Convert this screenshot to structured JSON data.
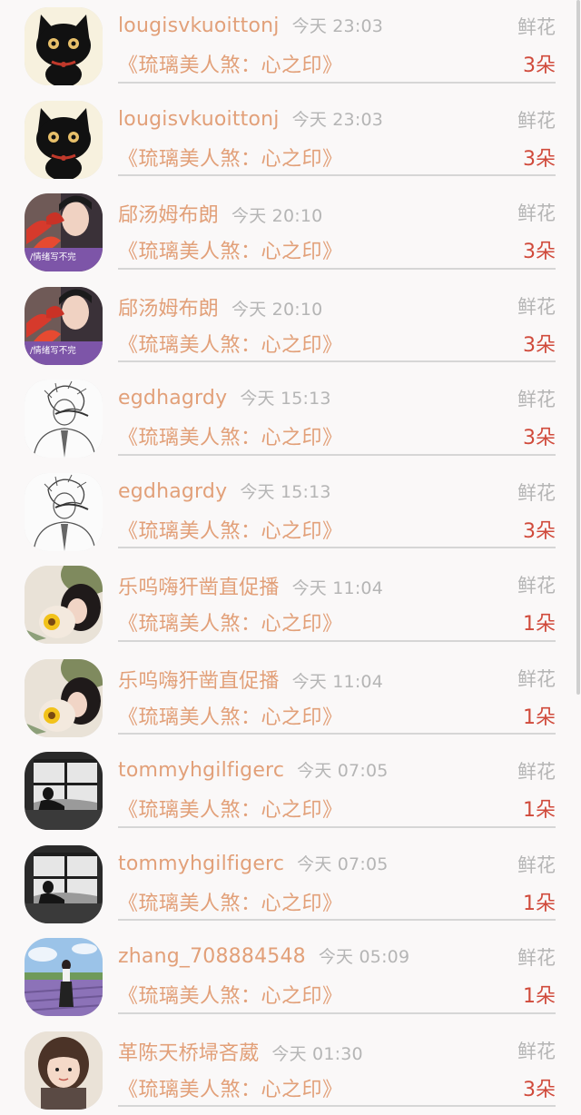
{
  "items": [
    {
      "name": "lougisvkuoittonj",
      "time": "今天 23:03",
      "gift": "鲜花",
      "title": "《琉璃美人煞：心之印》",
      "count": "3朵",
      "avatar": "black-cat"
    },
    {
      "name": "lougisvkuoittonj",
      "time": "今天 23:03",
      "gift": "鲜花",
      "title": "《琉璃美人煞：心之印》",
      "count": "3朵",
      "avatar": "black-cat"
    },
    {
      "name": "郈汤姆布朗",
      "time": "今天 20:10",
      "gift": "鲜花",
      "title": "《琉璃美人煞：心之印》",
      "count": "3朵",
      "avatar": "boy-flower",
      "avatar_caption": "/情绪写不完"
    },
    {
      "name": "郈汤姆布朗",
      "time": "今天 20:10",
      "gift": "鲜花",
      "title": "《琉璃美人煞：心之印》",
      "count": "3朵",
      "avatar": "boy-flower",
      "avatar_caption": "/情绪写不完"
    },
    {
      "name": "egdhagrdy",
      "time": "今天 15:13",
      "gift": "鲜花",
      "title": "《琉璃美人煞：心之印》",
      "count": "3朵",
      "avatar": "sketch-boy"
    },
    {
      "name": "egdhagrdy",
      "time": "今天 15:13",
      "gift": "鲜花",
      "title": "《琉璃美人煞：心之印》",
      "count": "3朵",
      "avatar": "sketch-boy"
    },
    {
      "name": "乐呜嗨犴凿直促播",
      "time": "今天 11:04",
      "gift": "鲜花",
      "title": "《琉璃美人煞：心之印》",
      "count": "1朵",
      "avatar": "girl-sunflower"
    },
    {
      "name": "乐呜嗨犴凿直促播",
      "time": "今天 11:04",
      "gift": "鲜花",
      "title": "《琉璃美人煞：心之印》",
      "count": "1朵",
      "avatar": "girl-sunflower"
    },
    {
      "name": "tommyhgilfigerc",
      "time": "今天 07:05",
      "gift": "鲜花",
      "title": "《琉璃美人煞：心之印》",
      "count": "1朵",
      "avatar": "window-silhouette"
    },
    {
      "name": "tommyhgilfigerc",
      "time": "今天 07:05",
      "gift": "鲜花",
      "title": "《琉璃美人煞：心之印》",
      "count": "1朵",
      "avatar": "window-silhouette"
    },
    {
      "name": "zhang_708884548",
      "time": "今天 05:09",
      "gift": "鲜花",
      "title": "《琉璃美人煞：心之印》",
      "count": "1朵",
      "avatar": "lavender-field"
    },
    {
      "name": "革陈天桥埽吝葳",
      "time": "今天 01:30",
      "gift": "鲜花",
      "title": "《琉璃美人煞：心之印》",
      "count": "3朵",
      "avatar": "little-girl"
    }
  ],
  "colors": {
    "name": "#e2a079",
    "title": "#e2a079",
    "meta": "#b5b5b5",
    "count": "#d04a3b",
    "background": "#faf8f8"
  }
}
